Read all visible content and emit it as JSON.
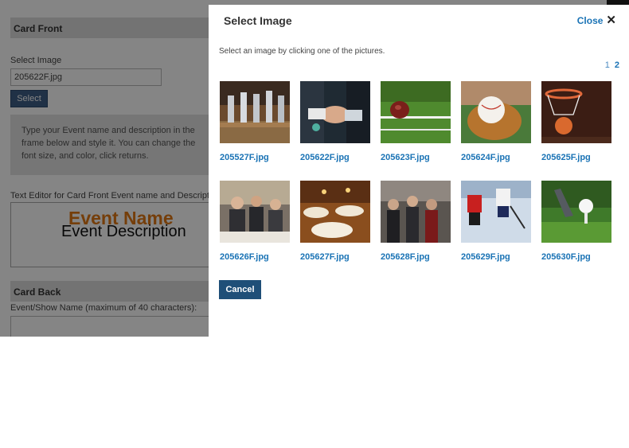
{
  "background": {
    "card_front_header": "Card Front",
    "select_image_label": "Select Image",
    "select_image_value": "205622F.jpg",
    "select_button": "Select",
    "info_text": "Type your Event name and description in the frame below and style it. You can change the font size, and color, click returns.",
    "editor_label": "Text Editor for Card Front Event name and Description",
    "event_name": "Event Name",
    "event_description": "Event Description",
    "card_back_header": "Card Back",
    "event_show_label": "Event/Show Name (maximum of 40 characters):"
  },
  "modal": {
    "title": "Select Image",
    "close_label": "Close",
    "close_icon": "close-icon",
    "instructions": "Select an image by clicking one of the pictures.",
    "pages": [
      "1",
      "2"
    ],
    "current_page": "1",
    "cancel_label": "Cancel",
    "images": [
      {
        "file": "205527F.jpg",
        "subject": "beer taps"
      },
      {
        "file": "205622F.jpg",
        "subject": "handshake"
      },
      {
        "file": "205623F.jpg",
        "subject": "football field"
      },
      {
        "file": "205624F.jpg",
        "subject": "baseball glove"
      },
      {
        "file": "205625F.jpg",
        "subject": "basketball hoop"
      },
      {
        "file": "205626F.jpg",
        "subject": "business dinner"
      },
      {
        "file": "205627F.jpg",
        "subject": "banquet hall"
      },
      {
        "file": "205628F.jpg",
        "subject": "crowd event"
      },
      {
        "file": "205629F.jpg",
        "subject": "hockey players"
      },
      {
        "file": "205630F.jpg",
        "subject": "golf ball on tee"
      }
    ]
  },
  "colors": {
    "link": "#1a73b5",
    "cancel_button": "#1f4f78",
    "event_name": "#e07814"
  }
}
